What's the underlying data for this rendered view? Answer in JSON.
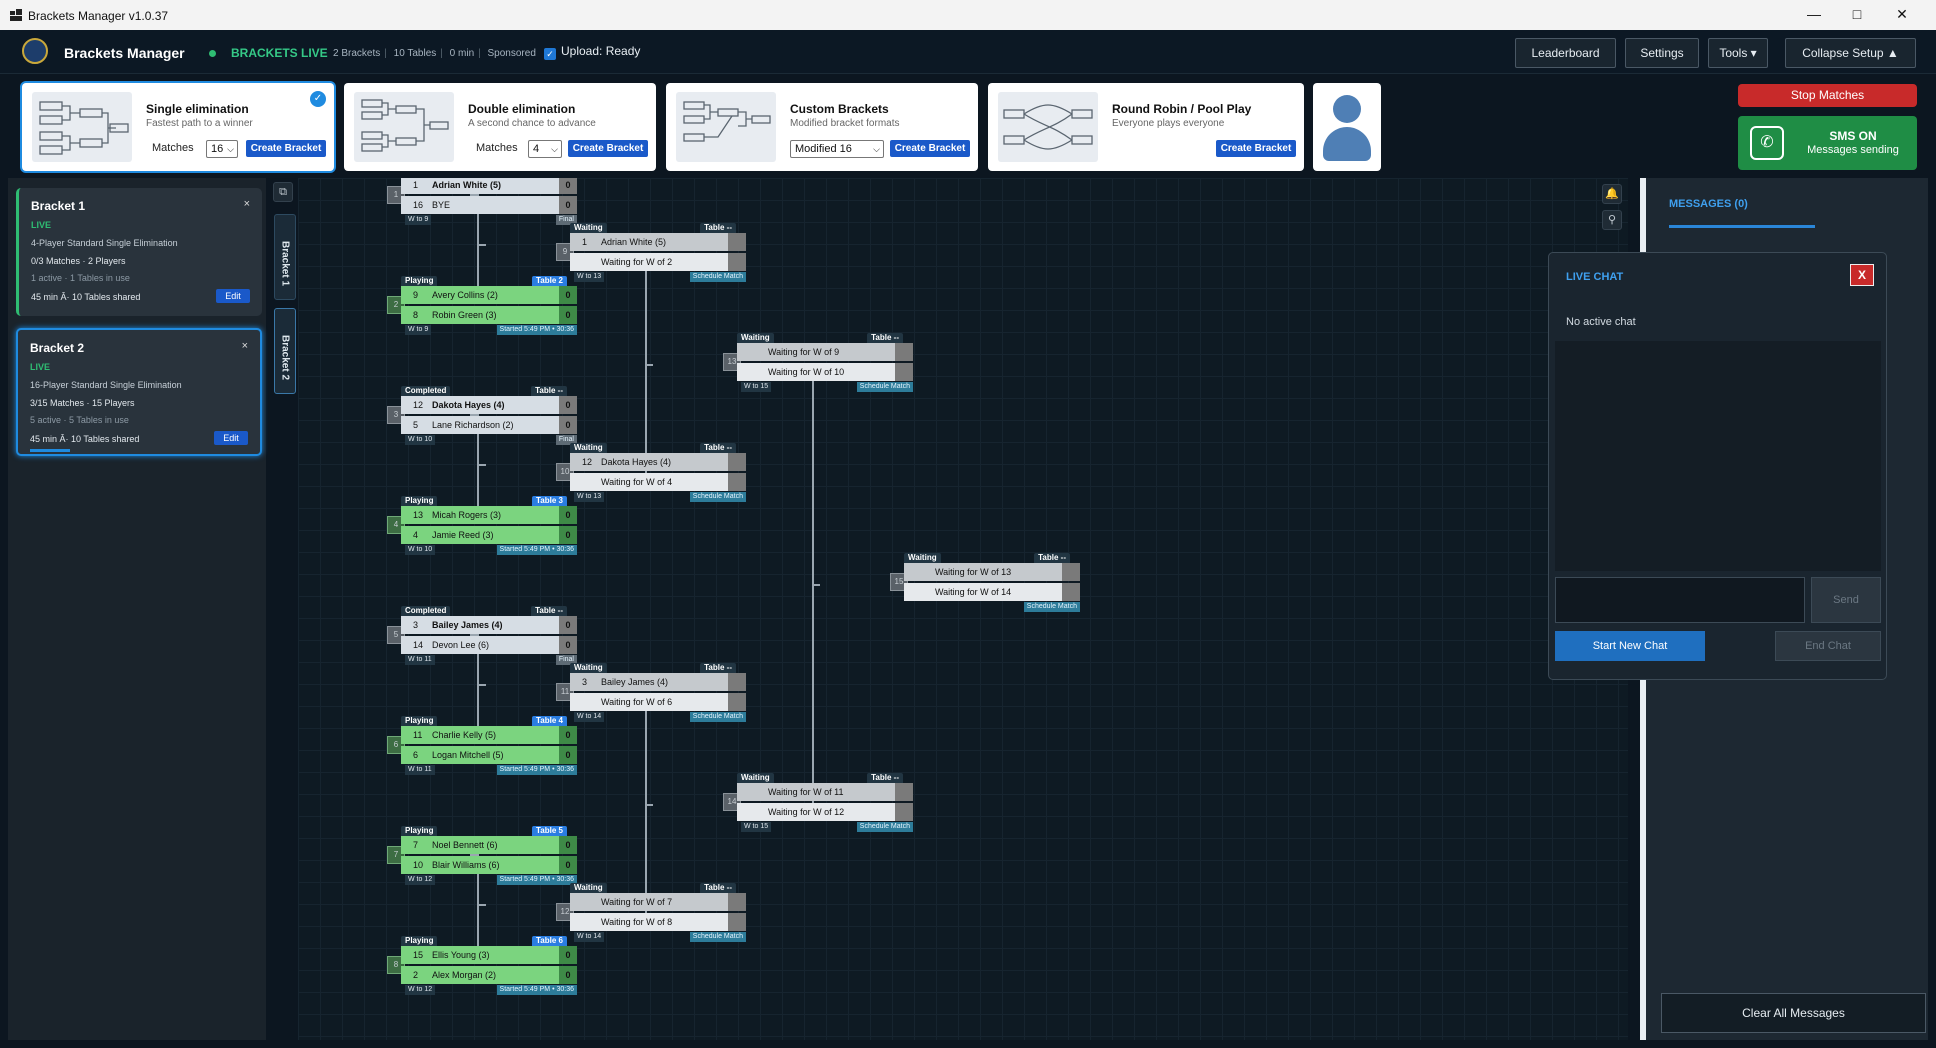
{
  "window": {
    "title": "Brackets Manager v1.0.37"
  },
  "header": {
    "app_name": "Brackets Manager",
    "live_label": "BRACKETS LIVE",
    "stats": [
      "2 Brackets",
      "10 Tables",
      "0 min",
      "Sponsored"
    ],
    "upload": "Upload: Ready",
    "buttons": {
      "leaderboard": "Leaderboard",
      "settings": "Settings",
      "tools": "Tools ▾",
      "collapse": "Collapse Setup ▲"
    }
  },
  "types": [
    {
      "title": "Single elimination",
      "subtitle": "Fastest path to a winner",
      "field_label": "Matches",
      "value": "16",
      "button": "Create Bracket"
    },
    {
      "title": "Double elimination",
      "subtitle": "A second chance to advance",
      "field_label": "Matches",
      "value": "4",
      "button": "Create Bracket"
    },
    {
      "title": "Custom Brackets",
      "subtitle": "Modified bracket formats",
      "value": "Modified 16",
      "button": "Create Bracket"
    },
    {
      "title": "Round Robin / Pool Play",
      "subtitle": "Everyone plays everyone",
      "button": "Create Bracket"
    }
  ],
  "actions": {
    "stop": "Stop Matches",
    "sms_title": "SMS ON",
    "sms_sub": "Messages sending"
  },
  "brackets": [
    {
      "name": "Bracket 1",
      "status": "LIVE",
      "desc": "4-Player Standard Single Elimination",
      "matches": "0/3 Matches  ·  2 Players",
      "active": "1 active  ·  1 Tables in use",
      "time": "45 min  Â·  10 Tables shared",
      "edit": "Edit",
      "close": "×"
    },
    {
      "name": "Bracket 2",
      "status": "LIVE",
      "desc": "16-Player Standard Single Elimination",
      "matches": "3/15 Matches  ·  15 Players",
      "active": "5 active  ·  5 Tables in use",
      "time": "45 min  Â·  10 Tables shared",
      "edit": "Edit",
      "close": "×"
    }
  ],
  "tabs": [
    "Bracket 1",
    "Bracket 2"
  ],
  "matches": {
    "m1": {
      "num": "1",
      "tag": "",
      "table": "",
      "s1": "1",
      "p1": "Adrian White (5)",
      "c1": "0",
      "s2": "16",
      "p2": "BYE",
      "c2": "0",
      "wt": "W to 9",
      "st": "Final"
    },
    "m2": {
      "num": "2",
      "tag": "Playing",
      "table": "Table 2",
      "s1": "9",
      "p1": "Avery Collins (2)",
      "c1": "0",
      "s2": "8",
      "p2": "Robin Green (3)",
      "c2": "0",
      "wt": "W to 9",
      "st": "Started 5:49 PM  •  30:36"
    },
    "m3": {
      "num": "3",
      "tag": "Completed",
      "table": "Table --",
      "s1": "12",
      "p1": "Dakota Hayes (4)",
      "c1": "0",
      "s2": "5",
      "p2": "Lane Richardson (2)",
      "c2": "0",
      "wt": "W to 10",
      "st": "Final"
    },
    "m4": {
      "num": "4",
      "tag": "Playing",
      "table": "Table 3",
      "s1": "13",
      "p1": "Micah Rogers (3)",
      "c1": "0",
      "s2": "4",
      "p2": "Jamie Reed (3)",
      "c2": "0",
      "wt": "W to 10",
      "st": "Started 5:49 PM  •  30:36"
    },
    "m5": {
      "num": "5",
      "tag": "Completed",
      "table": "Table --",
      "s1": "3",
      "p1": "Bailey James (4)",
      "c1": "0",
      "s2": "14",
      "p2": "Devon Lee (6)",
      "c2": "0",
      "wt": "W to 11",
      "st": "Final"
    },
    "m6": {
      "num": "6",
      "tag": "Playing",
      "table": "Table 4",
      "s1": "11",
      "p1": "Charlie Kelly (5)",
      "c1": "0",
      "s2": "6",
      "p2": "Logan Mitchell (5)",
      "c2": "0",
      "wt": "W to 11",
      "st": "Started 5:49 PM  •  30:36"
    },
    "m7": {
      "num": "7",
      "tag": "Playing",
      "table": "Table 5",
      "s1": "7",
      "p1": "Noel Bennett (6)",
      "c1": "0",
      "s2": "10",
      "p2": "Blair Williams (6)",
      "c2": "0",
      "wt": "W to 12",
      "st": "Started 5:49 PM  •  30:36"
    },
    "m8": {
      "num": "8",
      "tag": "Playing",
      "table": "Table 6",
      "s1": "15",
      "p1": "Ellis Young (3)",
      "c1": "0",
      "s2": "2",
      "p2": "Alex Morgan (2)",
      "c2": "0",
      "wt": "W to 12",
      "st": "Started 5:49 PM  •  30:36"
    },
    "m9": {
      "num": "9",
      "tag": "Waiting",
      "table": "Table --",
      "s1": "1",
      "p1": "Adrian White (5)",
      "c1": "",
      "s2": "",
      "p2": "Waiting for W of 2",
      "c2": "",
      "wt": "W to 13",
      "st": "Schedule Match"
    },
    "m10": {
      "num": "10",
      "tag": "Waiting",
      "table": "Table --",
      "s1": "12",
      "p1": "Dakota Hayes (4)",
      "c1": "",
      "s2": "",
      "p2": "Waiting for W of 4",
      "c2": "",
      "wt": "W to 13",
      "st": "Schedule Match"
    },
    "m11": {
      "num": "11",
      "tag": "Waiting",
      "table": "Table --",
      "s1": "3",
      "p1": "Bailey James (4)",
      "c1": "",
      "s2": "",
      "p2": "Waiting for W of 6",
      "c2": "",
      "wt": "W to 14",
      "st": "Schedule Match"
    },
    "m12": {
      "num": "12",
      "tag": "Waiting",
      "table": "Table --",
      "s1": "",
      "p1": "Waiting for W of 7",
      "c1": "",
      "s2": "",
      "p2": "Waiting for W of 8",
      "c2": "",
      "wt": "W to 14",
      "st": "Schedule Match"
    },
    "m13": {
      "num": "13",
      "tag": "Waiting",
      "table": "Table --",
      "s1": "",
      "p1": "Waiting for W of 9",
      "c1": "",
      "s2": "",
      "p2": "Waiting for W of 10",
      "c2": "",
      "wt": "W to 15",
      "st": "Schedule Match"
    },
    "m14": {
      "num": "14",
      "tag": "Waiting",
      "table": "Table --",
      "s1": "",
      "p1": "Waiting for W of 11",
      "c1": "",
      "s2": "",
      "p2": "Waiting for W of 12",
      "c2": "",
      "wt": "W to 15",
      "st": "Schedule Match"
    },
    "m15": {
      "num": "15",
      "tag": "Waiting",
      "table": "Table --",
      "s1": "",
      "p1": "Waiting for W of 13",
      "c1": "",
      "s2": "",
      "p2": "Waiting for W of 14",
      "c2": "",
      "wt": "",
      "st": "Schedule Match"
    }
  },
  "messages": {
    "title": "MESSAGES (0)",
    "clear": "Clear All Messages"
  },
  "chat": {
    "title": "LIVE CHAT",
    "close": "X",
    "status": "No active chat",
    "send": "Send",
    "start": "Start New Chat",
    "end": "End Chat"
  },
  "colors": {
    "accent": "#1f8be0",
    "live": "#2fbd73",
    "stop": "#c82a2a",
    "sms": "#1f8d45"
  }
}
